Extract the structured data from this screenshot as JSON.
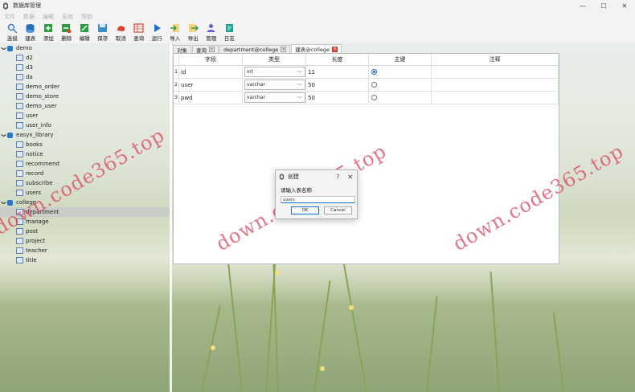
{
  "window": {
    "title": "数据库管理",
    "minimize": "—",
    "maximize": "☐",
    "close": "✕"
  },
  "menu": [
    "文件",
    "数据",
    "编辑",
    "系统",
    "帮助"
  ],
  "toolbar": [
    {
      "label": "连接",
      "icon": "connect-icon",
      "color": "#3a7fd0"
    },
    {
      "label": "建表",
      "icon": "create-table-icon",
      "color": "#2a6fb8"
    },
    {
      "label": "添加",
      "icon": "add-icon",
      "color": "#2e9b43"
    },
    {
      "label": "删除",
      "icon": "delete-icon",
      "color": "#2e9b43"
    },
    {
      "label": "编辑",
      "icon": "edit-icon",
      "color": "#2e9b43"
    },
    {
      "label": "保存",
      "icon": "save-icon",
      "color": "#3a8fc7"
    },
    {
      "label": "取消",
      "icon": "cancel-icon",
      "color": "#d9442f"
    },
    {
      "label": "查询",
      "icon": "query-icon",
      "color": "#d9442f"
    },
    {
      "label": "运行",
      "icon": "run-icon",
      "color": "#1e6fc7"
    },
    {
      "label": "导入",
      "icon": "import-icon",
      "color": "#e9b23b"
    },
    {
      "label": "导出",
      "icon": "export-icon",
      "color": "#e9b23b"
    },
    {
      "label": "管理",
      "icon": "manage-icon",
      "color": "#6a5ccf"
    },
    {
      "label": "日志",
      "icon": "log-icon",
      "color": "#19a28f"
    }
  ],
  "tree": [
    {
      "db": "demo",
      "tables": [
        "d2",
        "d3",
        "da",
        "demo_order",
        "demo_store",
        "demo_user",
        "user",
        "user_info"
      ]
    },
    {
      "db": "easyx_library",
      "tables": [
        "books",
        "notice",
        "recommend",
        "record",
        "subscribe",
        "users"
      ]
    },
    {
      "db": "college",
      "tables": [
        "department",
        "manage",
        "post",
        "project",
        "teacher",
        "title"
      ]
    }
  ],
  "selected_table": "department",
  "tabs": [
    {
      "label": "对象",
      "closable": false
    },
    {
      "label": "查询",
      "closable": true,
      "close_style": "grey"
    },
    {
      "label": "department@college",
      "closable": true,
      "close_style": "grey"
    },
    {
      "label": "建表@college",
      "closable": true,
      "close_style": "red",
      "active": true
    }
  ],
  "columns": {
    "field": "字段",
    "type": "类型",
    "length": "长度",
    "primary": "主键",
    "note": "注释"
  },
  "rows": [
    {
      "index": "1",
      "field": "id",
      "type": "int",
      "length": "11",
      "primary": true,
      "note": ""
    },
    {
      "index": "2",
      "field": "user",
      "type": "varchar",
      "length": "50",
      "primary": false,
      "note": ""
    },
    {
      "index": "3",
      "field": "pwd",
      "type": "varchar",
      "length": "50",
      "primary": false,
      "note": ""
    }
  ],
  "dialog": {
    "title": "创建",
    "help": "?",
    "close": "✕",
    "prompt": "请输入表名称",
    "value": "users",
    "ok": "OK",
    "cancel": "Cancel"
  },
  "watermarks": [
    "down.code365.top",
    "down.code365.top",
    "down.code365.top"
  ],
  "colors": {
    "accent": "#1e6fc7",
    "watermark": "#dc465f",
    "selected_row": "#c8c8c8"
  }
}
